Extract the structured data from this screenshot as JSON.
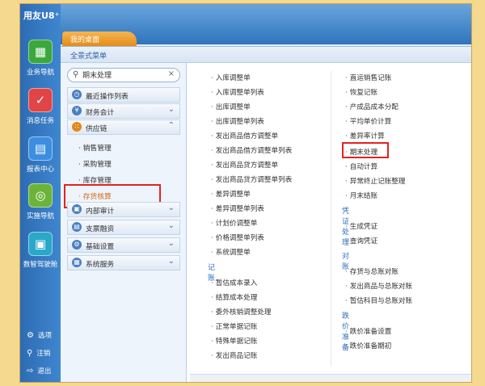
{
  "app": {
    "logo": "用友U8⁺",
    "home_tab": "我的桌面"
  },
  "left_nav": [
    {
      "label": "业务导航",
      "icon": "org-chart-icon",
      "color": "#3aa83c"
    },
    {
      "label": "消息任务",
      "icon": "message-icon",
      "color": "#e04444"
    },
    {
      "label": "报表中心",
      "icon": "report-icon",
      "color": "#3b8ee0"
    },
    {
      "label": "实施导航",
      "icon": "compass-icon",
      "color": "#6cb33a"
    },
    {
      "label": "数智驾驶舱",
      "icon": "cube-icon",
      "color": "#2aa8c8"
    }
  ],
  "bottom_links": [
    {
      "label": "选项",
      "icon": "gear-icon"
    },
    {
      "label": "注销",
      "icon": "key-icon"
    },
    {
      "label": "退出",
      "icon": "exit-icon"
    }
  ],
  "menu_header": "全景式菜单",
  "search": {
    "value": "期末处理",
    "placeholder": ""
  },
  "tree": {
    "recent": "最近操作列表",
    "finance": "财务会计",
    "supply": "供应链",
    "supply_children": [
      "销售管理",
      "采购管理",
      "库存管理",
      "存货核算"
    ],
    "internal_audit": "内部审计",
    "report": "支票融资",
    "basic": "基础设置",
    "system": "系统服务"
  },
  "col1": {
    "items": [
      "入库调整单",
      "入库调整单列表",
      "出库调整单",
      "出库调整单列表",
      "发出商品借方调整单",
      "发出商品借方调整单列表",
      "发出商品贷方调整单",
      "发出商品贷方调整单列表",
      "差异调整单",
      "差异调整单列表",
      "计划价调整单",
      "价格调整单列表",
      "系统调整单"
    ],
    "section": "记账",
    "items2": [
      "暂估成本录入",
      "结算成本处理",
      "委外核销调整处理",
      "正常单据记账",
      "特殊单据记账",
      "发出商品记账"
    ]
  },
  "col2": {
    "items": [
      "直运销售记账",
      "恢复记账",
      "产成品成本分配",
      "平均单价计算",
      "差异率计算",
      "期末处理",
      "自动计算",
      "异常终止记账整理",
      "月末结账"
    ],
    "section1": "凭证处理",
    "items_v": [
      "生成凭证",
      "查询凭证"
    ],
    "section2": "对账",
    "items_d": [
      "存货与总账对账",
      "发出商品与总账对账",
      "暂估科目与总账对账"
    ],
    "section3": "跌价准备",
    "items_p": [
      "跌价准备设置",
      "跌价准备期初"
    ]
  }
}
